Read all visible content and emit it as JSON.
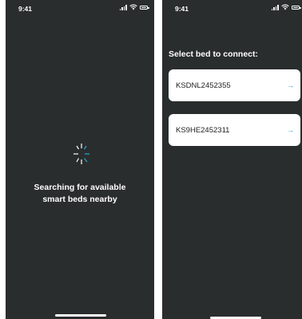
{
  "left_screen": {
    "status": {
      "time": "9:41"
    },
    "search_text": [
      "Searching for available",
      "smart beds nearby"
    ]
  },
  "right_screen": {
    "status": {
      "time": "9:41"
    },
    "title": "Select bed to connect:",
    "beds": [
      {
        "id": "KSDNL2452355",
        "arrow": "→"
      },
      {
        "id": "KS9HE2452311",
        "arrow": "→"
      }
    ]
  },
  "colors": {
    "background": "#2a2d2e",
    "card": "#ffffff",
    "accent": "#2aa7c9",
    "text": "#ffffff"
  },
  "icons": [
    "signal-icon",
    "wifi-icon",
    "battery-icon",
    "loading-spinner-icon",
    "arrow-right-icon"
  ]
}
